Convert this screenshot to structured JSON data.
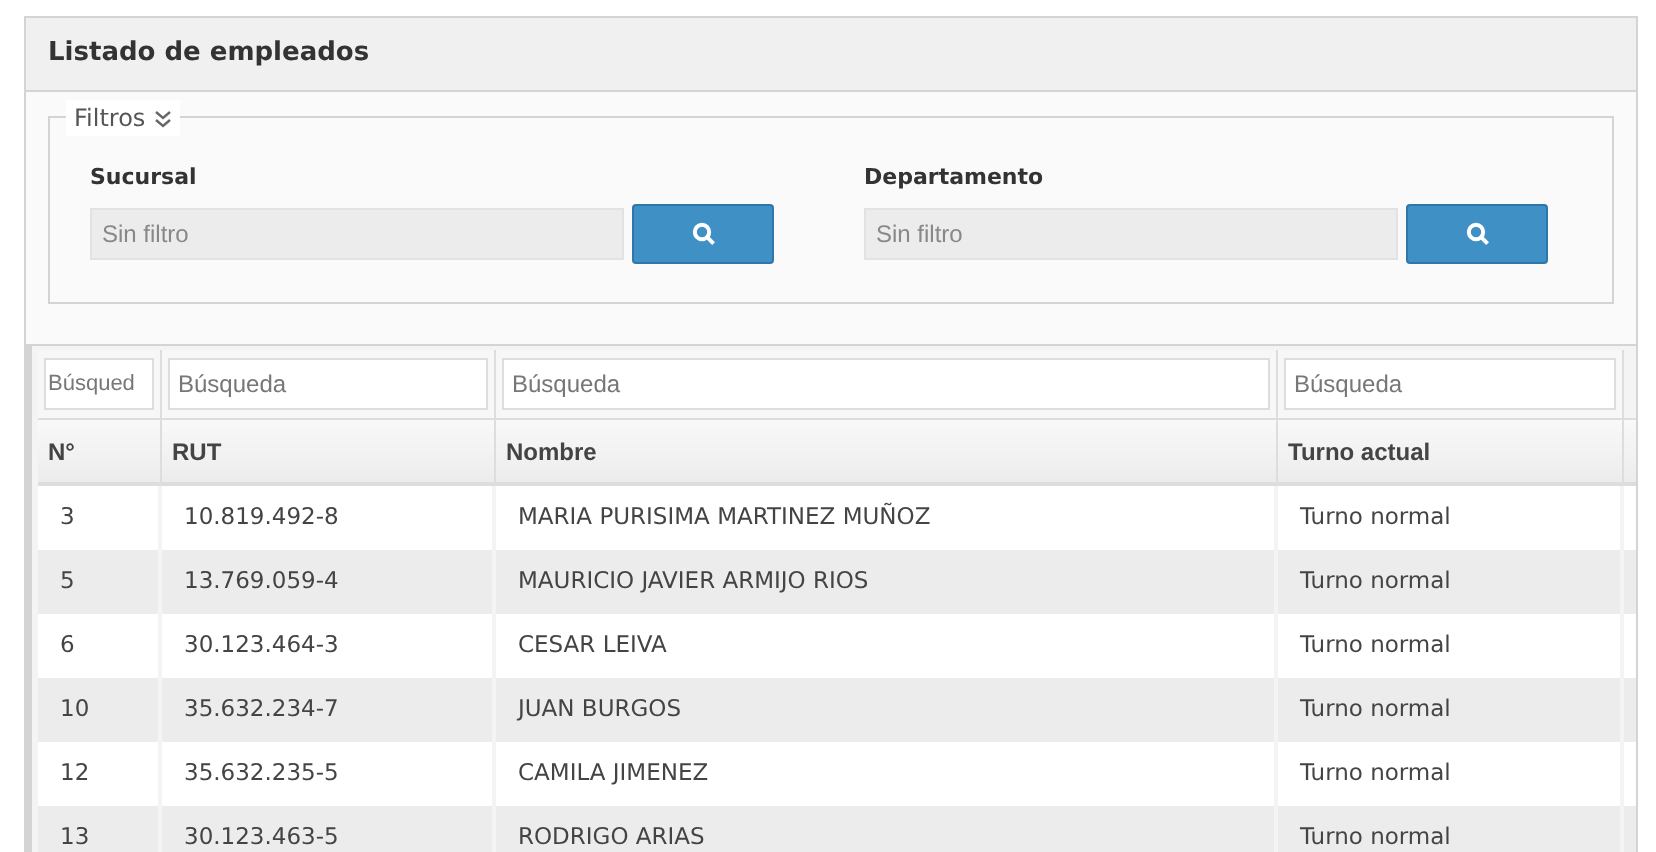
{
  "panel": {
    "title": "Listado de empleados"
  },
  "filters": {
    "legend": "Filtros",
    "fields": [
      {
        "label": "Sucursal",
        "placeholder": "Sin filtro"
      },
      {
        "label": "Departamento",
        "placeholder": "Sin filtro"
      }
    ]
  },
  "table": {
    "search_placeholders": [
      "Búsqued",
      "Búsqueda",
      "Búsqueda",
      "Búsqueda"
    ],
    "columns": [
      "N°",
      "RUT",
      "Nombre",
      "Turno actual"
    ],
    "rows": [
      [
        "3",
        "10.819.492-8",
        "MARIA PURISIMA MARTINEZ MUÑOZ",
        "Turno normal"
      ],
      [
        "5",
        "13.769.059-4",
        "MAURICIO JAVIER ARMIJO RIOS",
        "Turno normal"
      ],
      [
        "6",
        "30.123.464-3",
        "CESAR LEIVA",
        "Turno normal"
      ],
      [
        "10",
        "35.632.234-7",
        "JUAN BURGOS",
        "Turno normal"
      ],
      [
        "12",
        "35.632.235-5",
        "CAMILA JIMENEZ",
        "Turno normal"
      ],
      [
        "13",
        "30.123.463-5",
        "RODRIGO ARIAS",
        "Turno normal"
      ]
    ]
  }
}
